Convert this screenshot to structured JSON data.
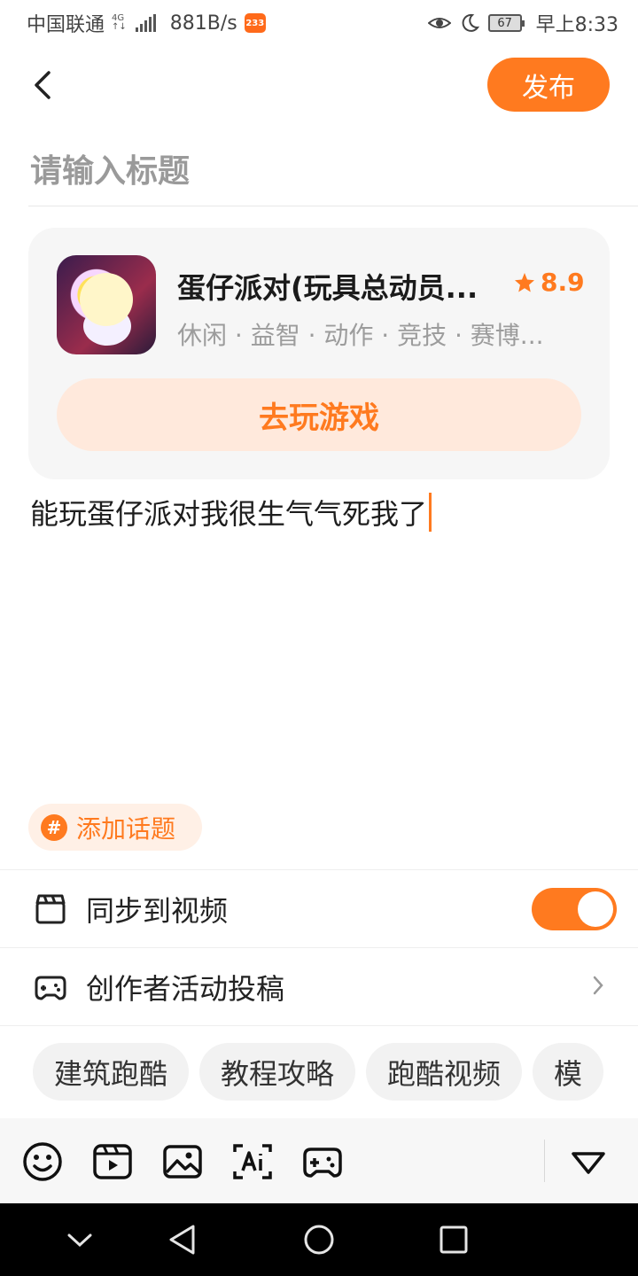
{
  "status_bar": {
    "carrier": "中国联通",
    "network": "4G",
    "speed": "881B/s",
    "app_badge": "233",
    "battery": "67",
    "time": "早上8:33"
  },
  "header": {
    "back_icon": "chevron-left-icon",
    "publish_label": "发布"
  },
  "title_input": {
    "placeholder": "请输入标题"
  },
  "game_card": {
    "name": "蛋仔派对(玩具总动员...",
    "rating": "8.9",
    "tags": "休闲 · 益智 · 动作 · 竞技 · 赛博...",
    "play_label": "去玩游戏"
  },
  "body_text": "能玩蛋仔派对我很生气气死我了",
  "topic": {
    "label": "添加话题",
    "icon": "#"
  },
  "sync_row": {
    "label": "同步到视频",
    "enabled": true
  },
  "activity_row": {
    "label": "创作者活动投稿"
  },
  "tag_suggestions": [
    "建筑跑酷",
    "教程攻略",
    "跑酷视频",
    "模"
  ],
  "toolbar": {
    "icons": [
      "emoji-icon",
      "video-icon",
      "image-icon",
      "ai-text-icon",
      "gamepad-icon",
      "collapse-icon"
    ]
  },
  "accent_color": "#ff7a1f"
}
